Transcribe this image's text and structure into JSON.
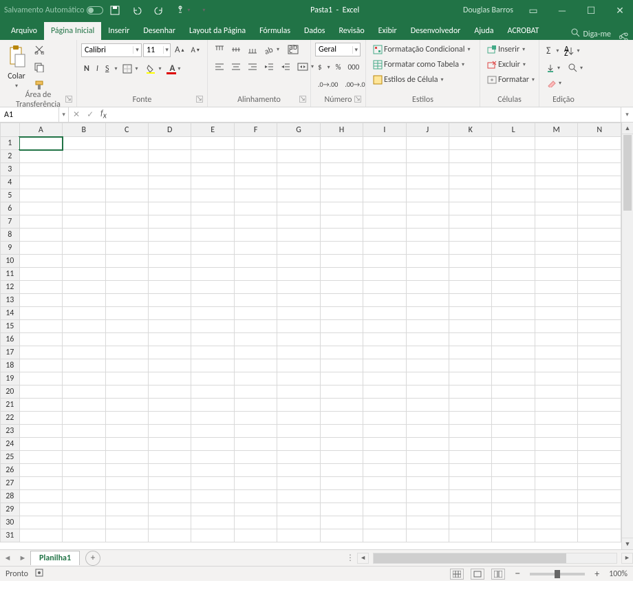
{
  "title": {
    "doc": "Pasta1",
    "app": "Excel",
    "autosave_label": "Salvamento Automático",
    "user": "Douglas Barros"
  },
  "tabs": {
    "file": "Arquivo",
    "items": [
      "Página Inicial",
      "Inserir",
      "Desenhar",
      "Layout da Página",
      "Fórmulas",
      "Dados",
      "Revisão",
      "Exibir",
      "Desenvolvedor",
      "Ajuda",
      "ACROBAT"
    ],
    "active": 0,
    "tellme": "Diga-me"
  },
  "ribbon": {
    "clipboard": {
      "label": "Área de Transferência",
      "paste": "Colar"
    },
    "font": {
      "label": "Fonte",
      "name": "Calibri",
      "size": "11",
      "bold": "N",
      "italic": "I",
      "underline": "S"
    },
    "alignment": {
      "label": "Alinhamento"
    },
    "number": {
      "label": "Número",
      "format": "Geral",
      "currency": "$",
      "percent": "%",
      "comma": "000"
    },
    "styles": {
      "label": "Estilos",
      "cond": "Formatação Condicional",
      "table": "Formatar como Tabela",
      "cell": "Estilos de Célula"
    },
    "cells": {
      "label": "Células",
      "insert": "Inserir",
      "delete": "Excluir",
      "format": "Formatar"
    },
    "editing": {
      "label": "Edição"
    }
  },
  "formula": {
    "namebox": "A1",
    "fx_placeholder": ""
  },
  "grid": {
    "cols": [
      "A",
      "B",
      "C",
      "D",
      "E",
      "F",
      "G",
      "H",
      "I",
      "J",
      "K",
      "L",
      "M",
      "N"
    ],
    "rows": 31,
    "active": "A1"
  },
  "sheets": {
    "nav_prev": "◄",
    "nav_next": "►",
    "tab": "Planilha1",
    "add": "+"
  },
  "status": {
    "ready": "Pronto",
    "zoom": "100%",
    "minus": "−",
    "plus": "+"
  }
}
